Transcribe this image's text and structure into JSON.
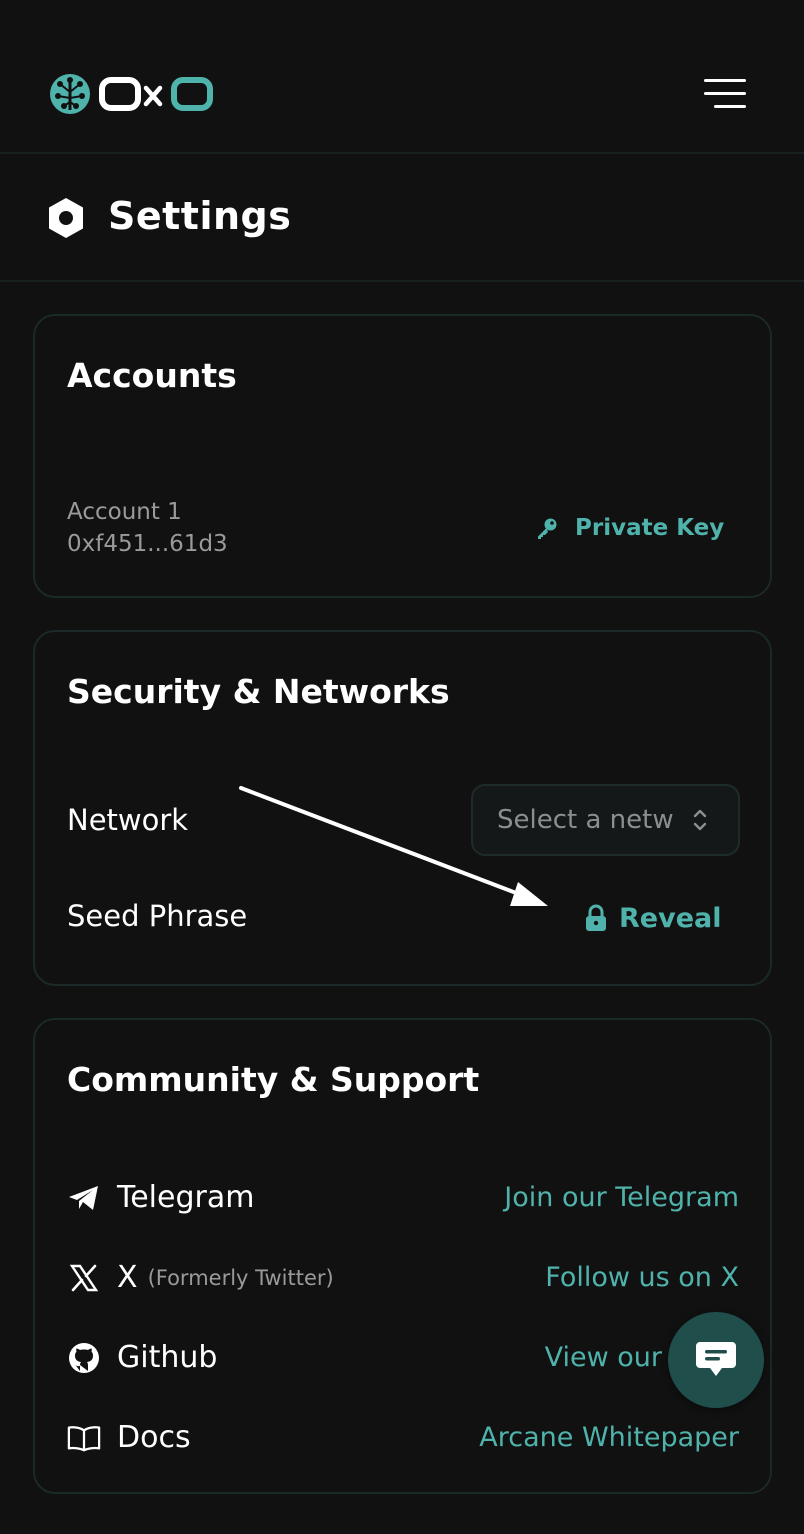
{
  "header": {
    "logo_text": "OxO",
    "menu_icon": "hamburger-icon"
  },
  "title": {
    "icon": "hexagon-settings-icon",
    "text": "Settings"
  },
  "accounts": {
    "title": "Accounts",
    "account_name": "Account 1",
    "account_address": "0xf451...61d3",
    "private_key_icon": "key-icon",
    "private_key_label": "Private Key"
  },
  "security": {
    "title": "Security & Networks",
    "network_label": "Network",
    "network_placeholder": "Select a netw",
    "seed_label": "Seed Phrase",
    "reveal_icon": "lock-icon",
    "reveal_label": "Reveal"
  },
  "community": {
    "title": "Community & Support",
    "rows": [
      {
        "icon": "telegram-icon",
        "name": "Telegram",
        "sub": "",
        "link": "Join our Telegram"
      },
      {
        "icon": "x-icon",
        "name": "X",
        "sub": "(Formerly Twitter)",
        "link": "Follow us on X"
      },
      {
        "icon": "github-icon",
        "name": "Github",
        "sub": "",
        "link": "View our Gi"
      },
      {
        "icon": "book-icon",
        "name": "Docs",
        "sub": "",
        "link": "Arcane Whitepaper"
      }
    ]
  },
  "chat_button_icon": "chat-icon",
  "colors": {
    "background": "#111111",
    "accent": "#4fb3ac",
    "card_border": "#1b2a28",
    "chat_button": "#1f4e4b"
  }
}
